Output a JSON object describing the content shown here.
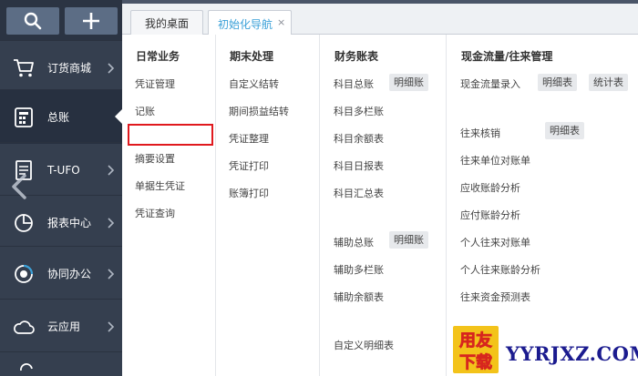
{
  "sidebar": {
    "items": [
      {
        "label": "订货商城",
        "icon": "cart-icon"
      },
      {
        "label": "总账",
        "icon": "ledger-icon"
      },
      {
        "label": "T-UFO",
        "icon": "report-file-icon"
      },
      {
        "label": "报表中心",
        "icon": "pie-chart-icon"
      },
      {
        "label": "协同办公",
        "icon": "collaboration-icon"
      },
      {
        "label": "云应用",
        "icon": "cloud-icon"
      }
    ]
  },
  "tabs": [
    {
      "label": "我的桌面"
    },
    {
      "label": "初始化导航",
      "close": "×"
    }
  ],
  "columns": {
    "daily": {
      "title": "日常业务",
      "items": [
        "凭证管理",
        "记账",
        "",
        "摘要设置",
        "单据生凭证",
        "凭证查询"
      ]
    },
    "period_end": {
      "title": "期末处理",
      "items": [
        "自定义结转",
        "期间损益结转",
        "凭证整理",
        "凭证打印",
        "账簿打印"
      ]
    },
    "accounts": {
      "title": "财务账表",
      "items": [
        "科目总账",
        "科目多栏账",
        "科目余额表",
        "科目日报表",
        "科目汇总表",
        "辅助总账",
        "辅助多栏账",
        "辅助余额表",
        "自定义明细表"
      ],
      "detail_pill": "明细账"
    },
    "cashflow": {
      "title": "现金流量/往来管理",
      "items": [
        "现金流量录入",
        "往来核销",
        "往来单位对账单",
        "应收账龄分析",
        "应付账龄分析",
        "个人往来对账单",
        "个人往来账龄分析",
        "往来资金预测表"
      ],
      "pills": {
        "detail": "明细表",
        "stats": "统计表"
      }
    }
  },
  "watermark": {
    "badge_top": "用友",
    "badge_bottom": "下载",
    "site": "YYRJXZ.COM"
  },
  "colors": {
    "sidebar_bg": "#353f4f",
    "accent": "#3aa0d8",
    "highlight": "#e0191e"
  }
}
